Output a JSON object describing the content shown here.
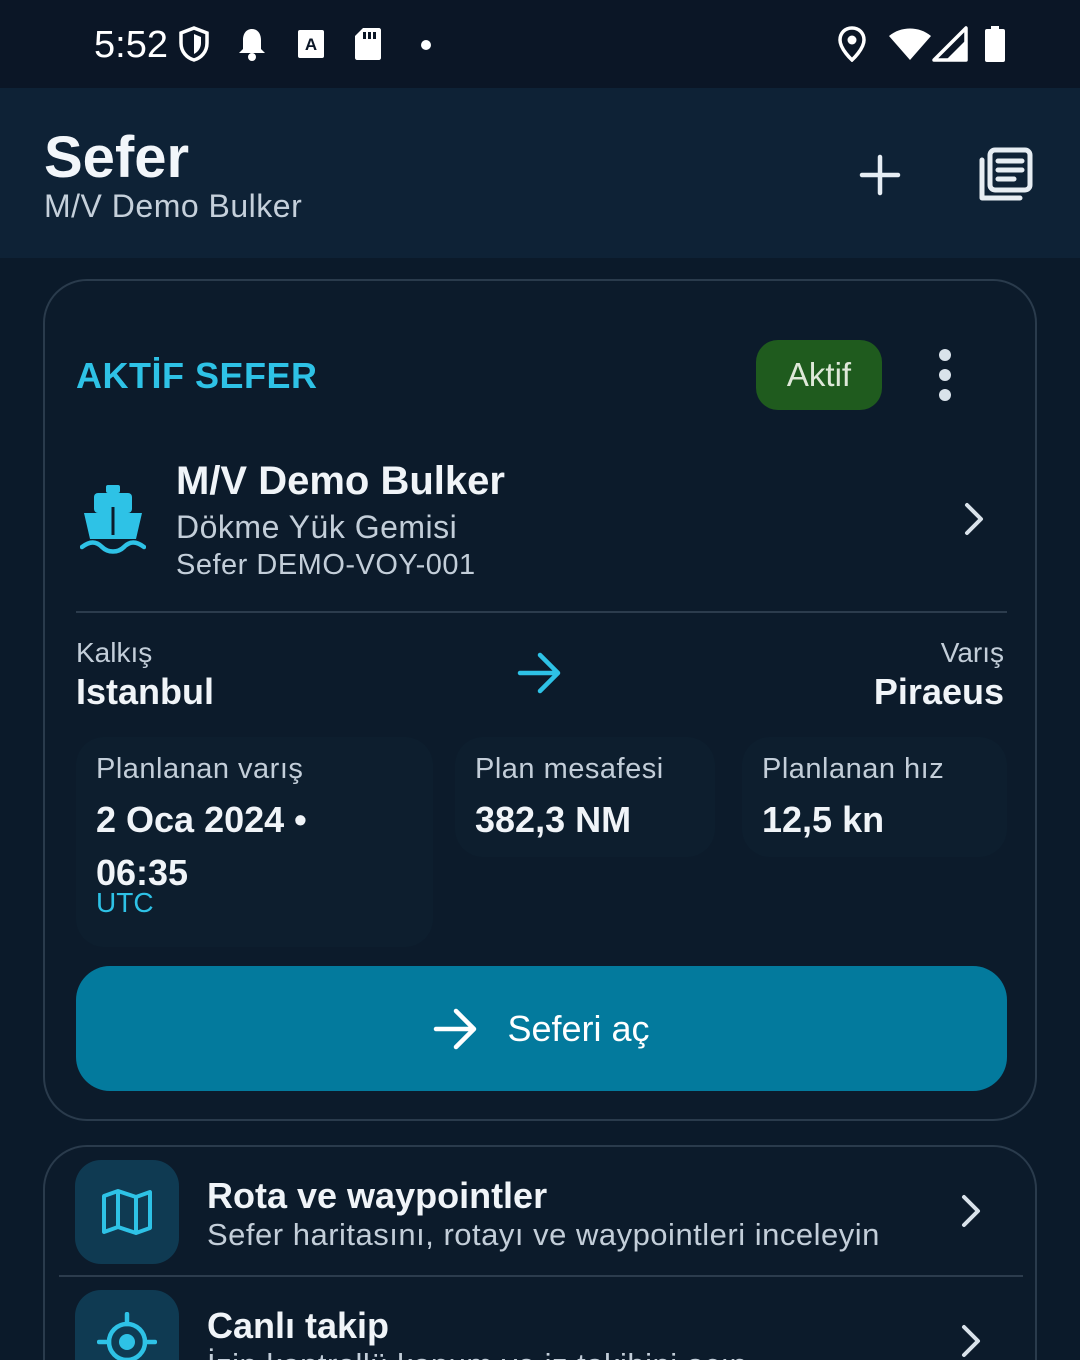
{
  "status_bar": {
    "time": "5:52",
    "icons": [
      "shield-icon",
      "notification-bell-icon",
      "keyboard-a-icon",
      "sd-card-icon",
      "dot-icon",
      "location-pin-icon",
      "wifi-icon",
      "cell-signal-icon",
      "battery-icon"
    ]
  },
  "app_bar": {
    "title": "Sefer",
    "subtitle": "M/V Demo Bulker",
    "actions": [
      "add-icon",
      "library-icon"
    ]
  },
  "active_voyage": {
    "section_label": "AKTİF SEFER",
    "status_badge": "Aktif",
    "vessel": {
      "name": "M/V Demo Bulker",
      "type": "Dökme Yük Gemisi",
      "voyage": "Sefer DEMO-VOY-001"
    },
    "route": {
      "departure_label": "Kalkış",
      "departure_city": "Istanbul",
      "arrival_label": "Varış",
      "arrival_city": "Piraeus"
    },
    "stats": {
      "eta_label": "Planlanan varış",
      "eta_value": "2 Oca 2024 • 06:35",
      "eta_unit": "UTC",
      "distance_label": "Plan mesafesi",
      "distance_value": "382,3 NM",
      "speed_label": "Planlanan hız",
      "speed_value": "12,5 kn"
    },
    "open_button": "Seferi aç"
  },
  "menu": [
    {
      "title": "Rota ve waypointler",
      "description": "Sefer haritasını, rotayı ve waypointleri inceleyin",
      "icon": "map-icon"
    },
    {
      "title": "Canlı takip",
      "description": "İzin kontrollü konum ve iz takibini açın",
      "icon": "gps-target-icon"
    }
  ],
  "colors": {
    "background": "#0b1a2a",
    "accent": "#2ec2e6",
    "primary_button": "#037a9d",
    "status_active": "#1f5b1e"
  }
}
